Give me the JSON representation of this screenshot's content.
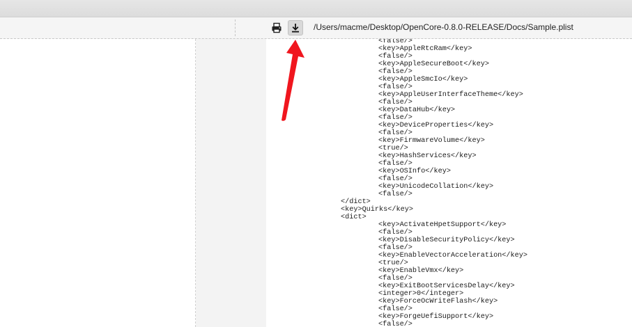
{
  "toolbar": {
    "file_path": "/Users/macme/Desktop/OpenCore-0.8.0-RELEASE/Docs/Sample.plist",
    "print_icon": "print-icon",
    "download_icon": "download-icon"
  },
  "annotation": {
    "arrow_color": "#f0161e",
    "arrow_icon": "red-arrow-pointing-up"
  },
  "code": {
    "lines": [
      {
        "indent": 2,
        "text": "<false/>"
      },
      {
        "indent": 2,
        "text": "<key>AppleRtcRam</key>"
      },
      {
        "indent": 2,
        "text": "<false/>"
      },
      {
        "indent": 2,
        "text": "<key>AppleSecureBoot</key>"
      },
      {
        "indent": 2,
        "text": "<false/>"
      },
      {
        "indent": 2,
        "text": "<key>AppleSmcIo</key>"
      },
      {
        "indent": 2,
        "text": "<false/>"
      },
      {
        "indent": 2,
        "text": "<key>AppleUserInterfaceTheme</key>"
      },
      {
        "indent": 2,
        "text": "<false/>"
      },
      {
        "indent": 2,
        "text": "<key>DataHub</key>"
      },
      {
        "indent": 2,
        "text": "<false/>"
      },
      {
        "indent": 2,
        "text": "<key>DeviceProperties</key>"
      },
      {
        "indent": 2,
        "text": "<false/>"
      },
      {
        "indent": 2,
        "text": "<key>FirmwareVolume</key>"
      },
      {
        "indent": 2,
        "text": "<true/>"
      },
      {
        "indent": 2,
        "text": "<key>HashServices</key>"
      },
      {
        "indent": 2,
        "text": "<false/>"
      },
      {
        "indent": 2,
        "text": "<key>OSInfo</key>"
      },
      {
        "indent": 2,
        "text": "<false/>"
      },
      {
        "indent": 2,
        "text": "<key>UnicodeCollation</key>"
      },
      {
        "indent": 2,
        "text": "<false/>"
      },
      {
        "indent": 1,
        "text": "</dict>"
      },
      {
        "indent": 1,
        "text": "<key>Quirks</key>"
      },
      {
        "indent": 1,
        "text": "<dict>"
      },
      {
        "indent": 2,
        "text": "<key>ActivateHpetSupport</key>"
      },
      {
        "indent": 2,
        "text": "<false/>"
      },
      {
        "indent": 2,
        "text": "<key>DisableSecurityPolicy</key>"
      },
      {
        "indent": 2,
        "text": "<false/>"
      },
      {
        "indent": 2,
        "text": "<key>EnableVectorAcceleration</key>"
      },
      {
        "indent": 2,
        "text": "<true/>"
      },
      {
        "indent": 2,
        "text": "<key>EnableVmx</key>"
      },
      {
        "indent": 2,
        "text": "<false/>"
      },
      {
        "indent": 2,
        "text": "<key>ExitBootServicesDelay</key>"
      },
      {
        "indent": 2,
        "text": "<integer>0</integer>"
      },
      {
        "indent": 2,
        "text": "<key>ForceOcWriteFlash</key>"
      },
      {
        "indent": 2,
        "text": "<false/>"
      },
      {
        "indent": 2,
        "text": "<key>ForgeUefiSupport</key>"
      },
      {
        "indent": 2,
        "text": "<false/>"
      }
    ]
  }
}
